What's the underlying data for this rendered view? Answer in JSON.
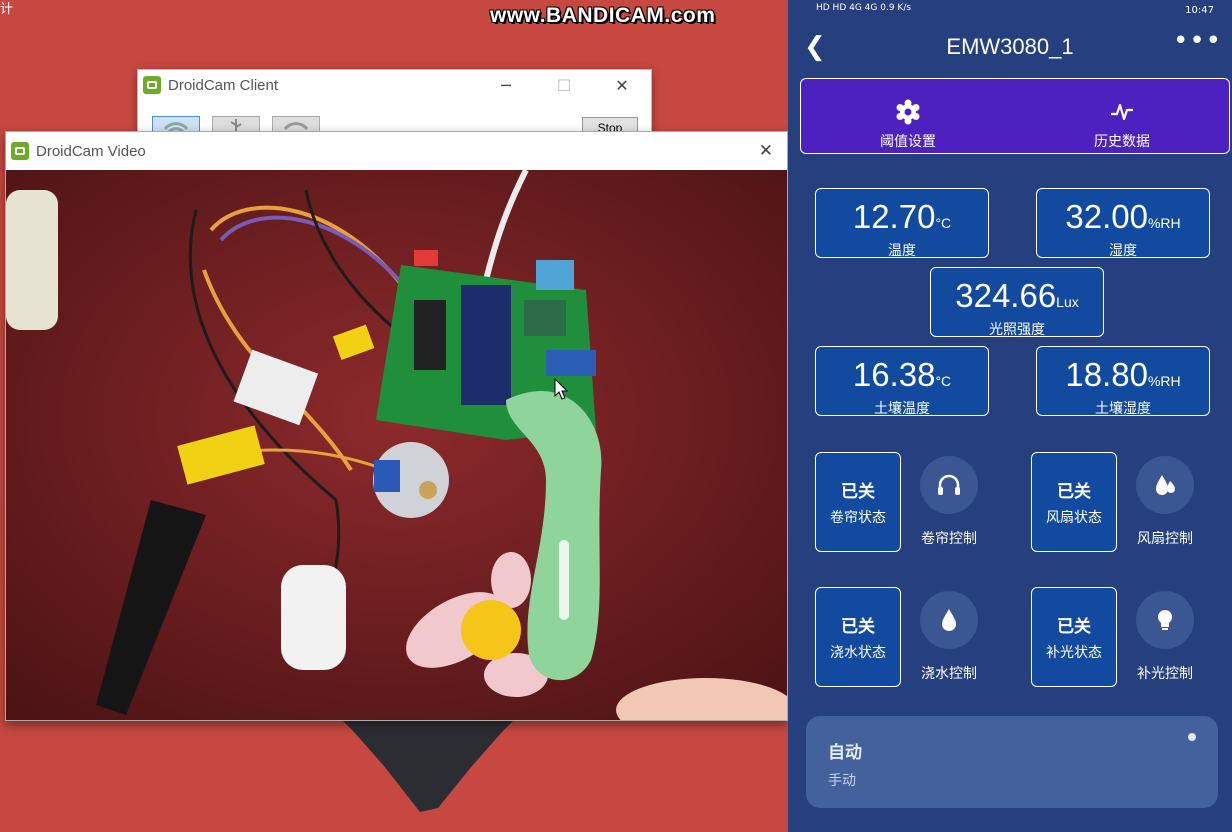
{
  "desktop": {
    "corner_text": "计"
  },
  "watermark": "www.BANDICAM.com",
  "droidcam_client": {
    "title": "DroidCam Client",
    "stop_label": "Stop"
  },
  "droidcam_video": {
    "title": "DroidCam Video"
  },
  "phone": {
    "status_bar": {
      "left": "HD HD 4G 4G 0.9 K/s",
      "right": "10:47"
    },
    "title": "EMW3080_1",
    "tabs": [
      {
        "label": "阈值设置",
        "icon": "settings-gear-icon"
      },
      {
        "label": "历史数据",
        "icon": "line-chart-icon"
      }
    ],
    "sensors": {
      "temperature": {
        "value": "12.70",
        "unit": "°C",
        "label": "温度"
      },
      "humidity": {
        "value": "32.00",
        "unit": "%RH",
        "label": "湿度"
      },
      "light": {
        "value": "324.66",
        "unit": "Lux",
        "label": "光照强度"
      },
      "soil_temperature": {
        "value": "16.38",
        "unit": "°C",
        "label": "土壤温度"
      },
      "soil_humidity": {
        "value": "18.80",
        "unit": "%RH",
        "label": "土壤湿度"
      }
    },
    "devices": [
      {
        "state": "已关",
        "status_label": "卷帘状态",
        "control_label": "卷帘控制",
        "icon": "headphone-icon"
      },
      {
        "state": "已关",
        "status_label": "风扇状态",
        "control_label": "风扇控制",
        "icon": "drops-icon"
      },
      {
        "state": "已关",
        "status_label": "浇水状态",
        "control_label": "浇水控制",
        "icon": "water-drop-icon"
      },
      {
        "state": "已关",
        "status_label": "补光状态",
        "control_label": "补光控制",
        "icon": "lightbulb-icon"
      }
    ],
    "mode": {
      "selected": "自动",
      "option": "手动"
    }
  },
  "colors": {
    "desktop_bg": "#c64840",
    "phone_bg": "#253f7f",
    "tab_bg": "#4d21bf",
    "card_bg": "#124aa0"
  }
}
